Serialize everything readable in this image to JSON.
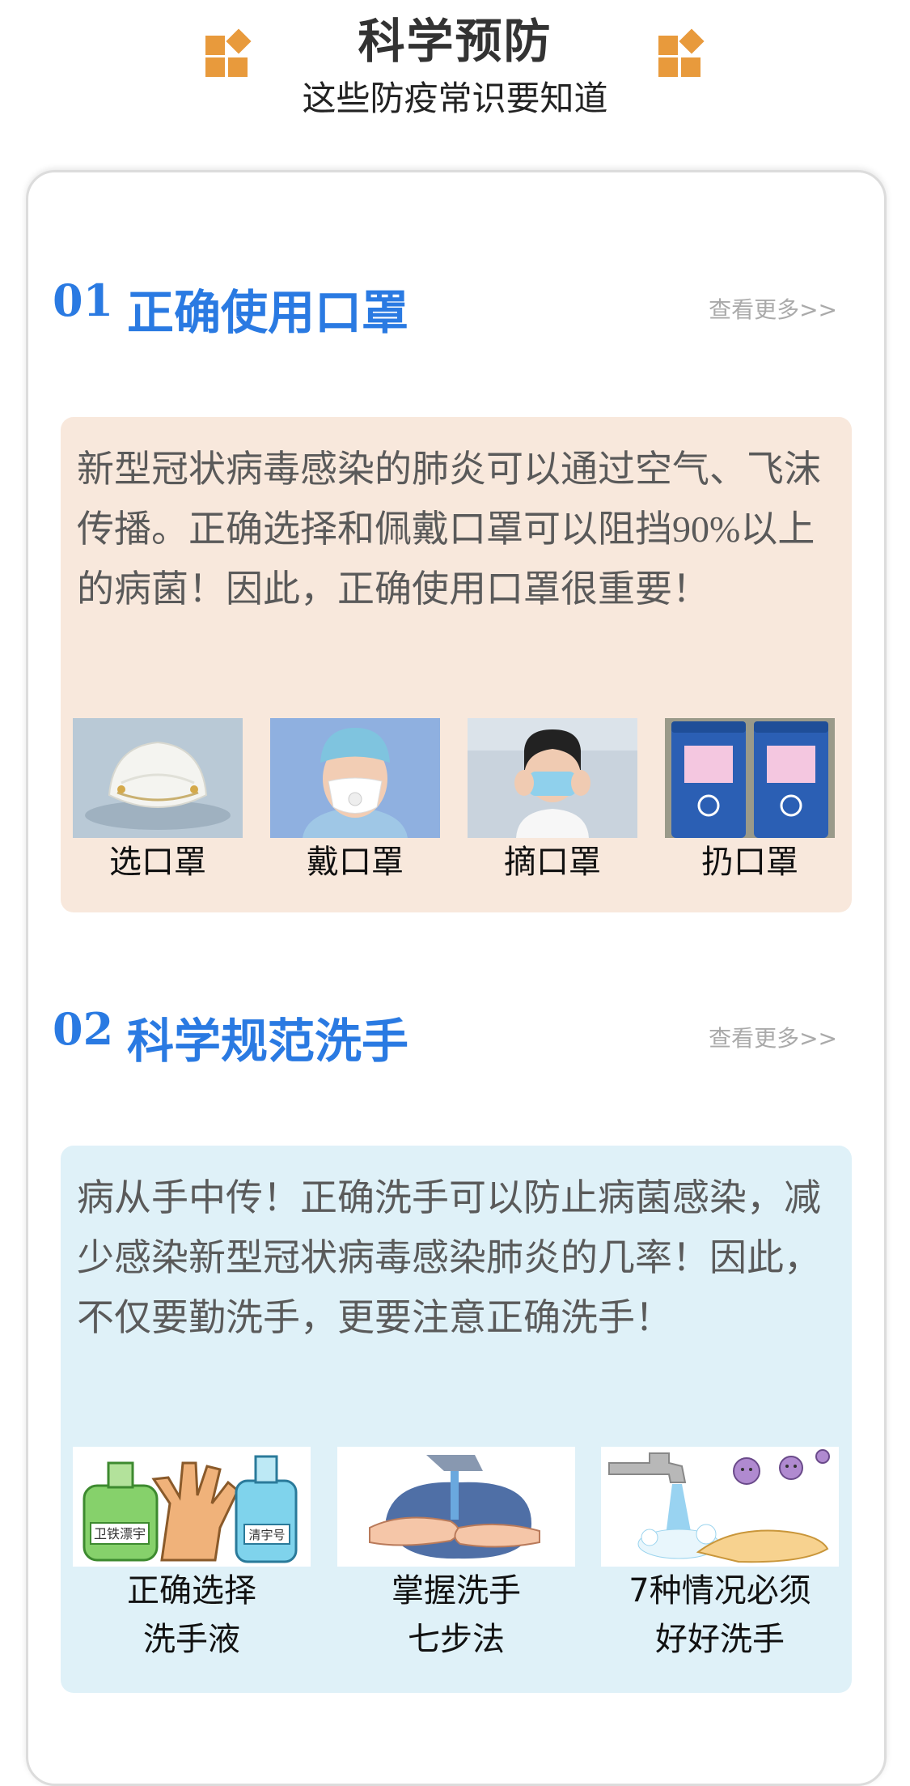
{
  "header": {
    "title": "科学预防",
    "subtitle": "这些防疫常识要知道",
    "accent_color": "#e89a3c"
  },
  "sections": [
    {
      "number": "01",
      "title": "正确使用口罩",
      "more_label": "查看更多>>",
      "description": "新型冠状病毒感染的肺炎可以通过空气、飞沫传播。正确选择和佩戴口罩可以阻挡90%以上的病菌！因此，正确使用口罩很重要！",
      "items": [
        {
          "label": "选口罩",
          "icon": "n95-mask-photo"
        },
        {
          "label": "戴口罩",
          "icon": "nurse-wearing-mask-photo"
        },
        {
          "label": "摘口罩",
          "icon": "removing-mask-photo"
        },
        {
          "label": "扔口罩",
          "icon": "mask-disposal-bins-photo"
        }
      ]
    },
    {
      "number": "02",
      "title": "科学规范洗手",
      "more_label": "查看更多>>",
      "description": "病从手中传！正确洗手可以防止病菌感染，减少感染新型冠状病毒感染肺炎的几率！因此，不仅要勤洗手，更要注意正确洗手！",
      "items": [
        {
          "label_line1": "正确选择",
          "label_line2": "洗手液",
          "icon": "hand-sanitizer-illustration",
          "bottle_label_1": "卫铁漂宇",
          "bottle_label_2": "清宇号"
        },
        {
          "label_line1": "掌握洗手",
          "label_line2": "七步法",
          "icon": "washing-hands-illustration"
        },
        {
          "label_line1": "7种情况必须",
          "label_line2": "好好洗手",
          "icon": "faucet-germs-illustration"
        }
      ]
    }
  ],
  "colors": {
    "section_title": "#2a7ae2",
    "box_peach": "#f8e8dc",
    "box_blue": "#dff1f8"
  }
}
